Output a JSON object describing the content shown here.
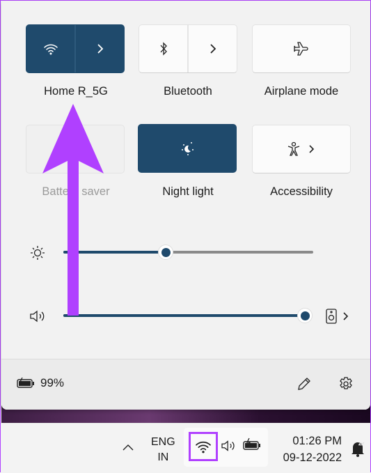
{
  "quick_settings": {
    "tiles": [
      {
        "label": "Home R_5G",
        "icon": "wifi-icon",
        "state": "on",
        "has_chevron": true
      },
      {
        "label": "Bluetooth",
        "icon": "bluetooth-icon",
        "state": "off",
        "has_chevron": true
      },
      {
        "label": "Airplane mode",
        "icon": "airplane-icon",
        "state": "off"
      },
      {
        "label": "Battery saver",
        "icon": "battery-saver-icon",
        "state": "disabled"
      },
      {
        "label": "Night light",
        "icon": "night-light-icon",
        "state": "on"
      },
      {
        "label": "Accessibility",
        "icon": "accessibility-icon",
        "state": "off",
        "has_chevron": true
      }
    ],
    "brightness_percent": 41,
    "volume_percent": 100,
    "battery_text": "99%",
    "accent": "#1f4a6c"
  },
  "taskbar": {
    "lang_line1": "ENG",
    "lang_line2": "IN",
    "time": "01:26 PM",
    "date": "09-12-2022"
  },
  "annotation_color": "#b040ff"
}
